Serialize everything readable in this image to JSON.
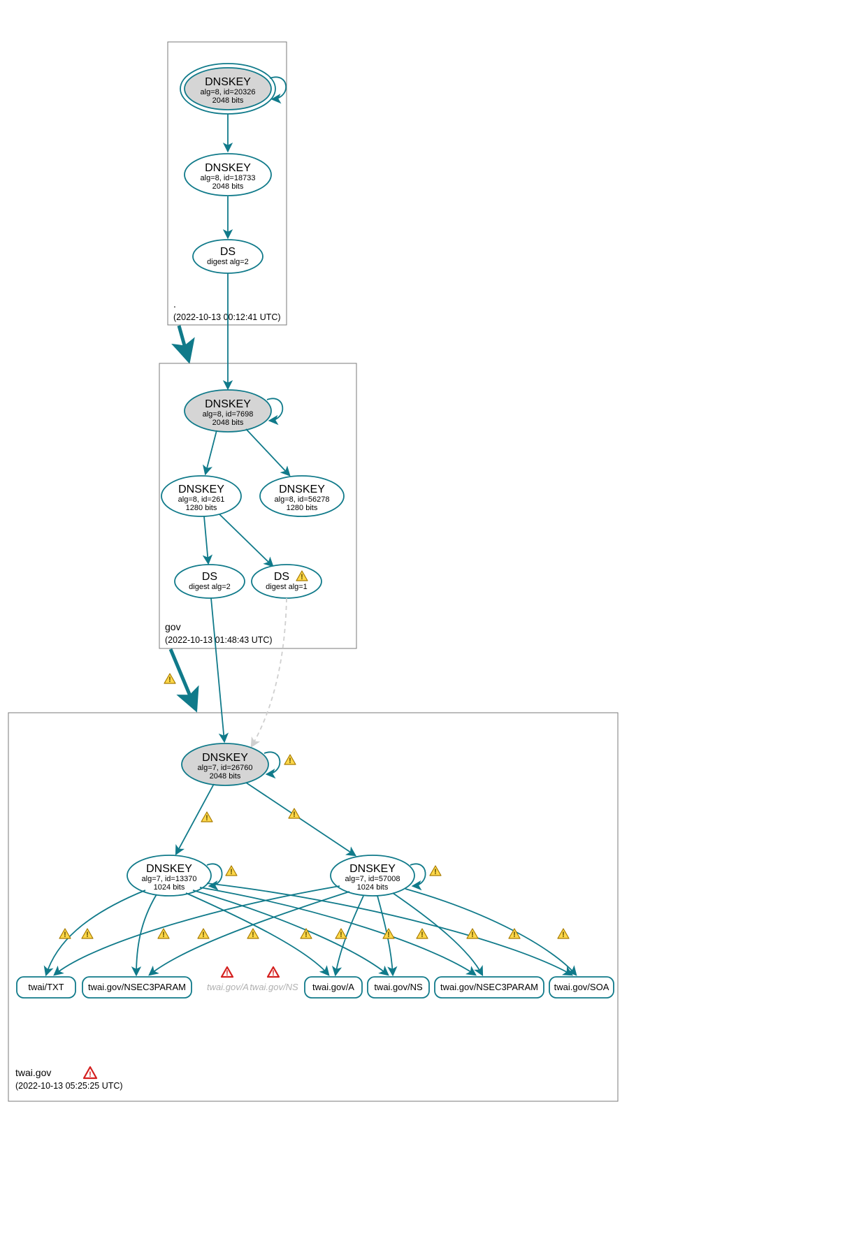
{
  "zones": {
    "root": {
      "label": ".",
      "timestamp": "(2022-10-13 00:12:41 UTC)"
    },
    "gov": {
      "label": "gov",
      "timestamp": "(2022-10-13 01:48:43 UTC)"
    },
    "twai": {
      "label": "twai.gov",
      "timestamp": "(2022-10-13 05:25:25 UTC)"
    }
  },
  "nodes": {
    "root_ksk": {
      "title": "DNSKEY",
      "line2": "alg=8, id=20326",
      "line3": "2048 bits"
    },
    "root_zsk": {
      "title": "DNSKEY",
      "line2": "alg=8, id=18733",
      "line3": "2048 bits"
    },
    "root_ds": {
      "title": "DS",
      "line2": "digest alg=2"
    },
    "gov_ksk": {
      "title": "DNSKEY",
      "line2": "alg=8, id=7698",
      "line3": "2048 bits"
    },
    "gov_zsk1": {
      "title": "DNSKEY",
      "line2": "alg=8, id=261",
      "line3": "1280 bits"
    },
    "gov_zsk2": {
      "title": "DNSKEY",
      "line2": "alg=8, id=56278",
      "line3": "1280 bits"
    },
    "gov_ds1": {
      "title": "DS",
      "line2": "digest alg=2"
    },
    "gov_ds2": {
      "title": "DS",
      "line2": "digest alg=1"
    },
    "twai_ksk": {
      "title": "DNSKEY",
      "line2": "alg=7, id=26760",
      "line3": "2048 bits"
    },
    "twai_zsk1": {
      "title": "DNSKEY",
      "line2": "alg=7, id=13370",
      "line3": "1024 bits"
    },
    "twai_zsk2": {
      "title": "DNSKEY",
      "line2": "alg=7, id=57008",
      "line3": "1024 bits"
    }
  },
  "rrsets": {
    "txt": "twai/TXT",
    "nsec3a": "twai.gov/NSEC3PARAM",
    "grey_a": "twai.gov/A",
    "grey_ns": "twai.gov/NS",
    "a": "twai.gov/A",
    "ns": "twai.gov/NS",
    "nsec3b": "twai.gov/NSEC3PARAM",
    "soa": "twai.gov/SOA"
  }
}
